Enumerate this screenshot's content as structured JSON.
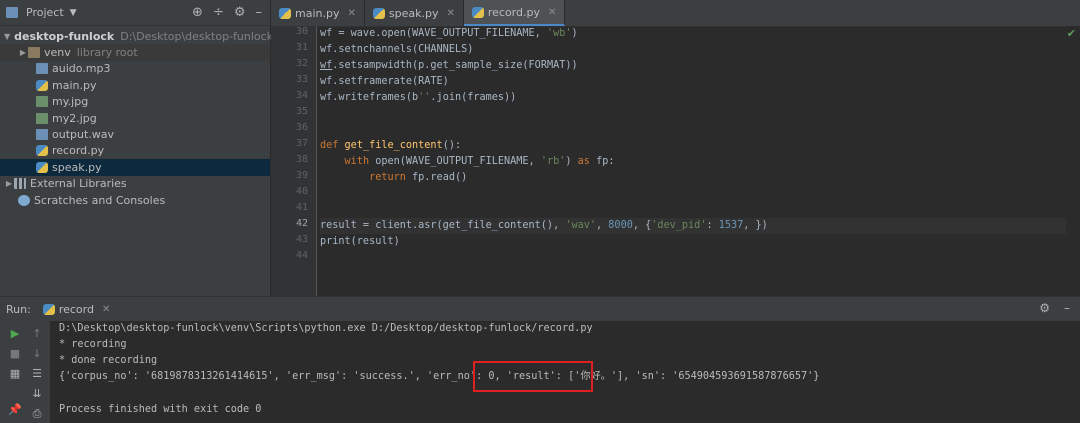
{
  "project": {
    "title": "Project",
    "tree": [
      {
        "label": "desktop-funlock",
        "extra": "D:\\Desktop\\desktop-funlock",
        "type": "folder-root"
      },
      {
        "label": "venv",
        "extra": "library root",
        "type": "folder"
      },
      {
        "label": "auido.mp3",
        "type": "audio"
      },
      {
        "label": "main.py",
        "type": "py"
      },
      {
        "label": "my.jpg",
        "type": "img"
      },
      {
        "label": "my2.jpg",
        "type": "img"
      },
      {
        "label": "output.wav",
        "type": "audio"
      },
      {
        "label": "record.py",
        "type": "py"
      },
      {
        "label": "speak.py",
        "type": "py"
      },
      {
        "label": "External Libraries",
        "type": "lib"
      },
      {
        "label": "Scratches and Consoles",
        "type": "scratch"
      }
    ]
  },
  "tabs": [
    {
      "label": "main.py"
    },
    {
      "label": "speak.py"
    },
    {
      "label": "record.py"
    }
  ],
  "editor": {
    "line_numbers": [
      "30",
      "31",
      "32",
      "33",
      "34",
      "35",
      "36",
      "37",
      "38",
      "39",
      "40",
      "41",
      "42",
      "43",
      "44"
    ],
    "code": [
      "wf = wave.open(WAVE_OUTPUT_FILENAME, 'wb')",
      "wf.setnchannels(CHANNELS)",
      "wf.setsampwidth(p.get_sample_size(FORMAT))",
      "wf.setframerate(RATE)",
      "wf.writeframes(b''.join(frames))",
      "",
      "",
      "def get_file_content():",
      "    with open(WAVE_OUTPUT_FILENAME, 'rb') as fp:",
      "        return fp.read()",
      "",
      "",
      "result = client.asr(get_file_content(), 'wav', 8000, {'dev_pid': 1537, })",
      "print(result)",
      ""
    ]
  },
  "run": {
    "label": "Run:",
    "tab": "record",
    "console": [
      "D:\\Desktop\\desktop-funlock\\venv\\Scripts\\python.exe D:/Desktop/desktop-funlock/record.py",
      "* recording",
      "* done recording",
      "{'corpus_no': '6819878313261414615', 'err_msg': 'success.', 'err_no': 0, 'result': ['你好。'], 'sn': '654904593691587876657'}",
      "",
      "Process finished with exit code 0"
    ]
  },
  "colors": {
    "keyword": "#cc7832",
    "function": "#ffc66d",
    "string": "#6a8759",
    "number": "#6897bb",
    "highlight_box": "#e02020"
  }
}
